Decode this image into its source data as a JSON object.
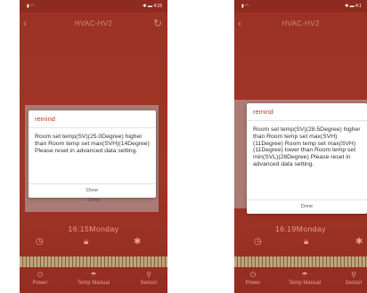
{
  "screen_left": {
    "status_left": "▮ ◠",
    "status_right": "✱ ▬ 4:15",
    "app_title": "HVAC-HV2",
    "dialog": {
      "title": "remind",
      "message": "Room set temp(SV)(25.0Degree) higher than Room temp set max(SVH)(14Degree) Please reset in advanced data setting.",
      "done_label": "Done"
    },
    "behind_done_label": "Done",
    "time_label": "16:15Monday",
    "bottom_buttons": [
      {
        "label": "Power",
        "icon": "power-icon"
      },
      {
        "label": "Temp Manual",
        "icon": "temp-manual-icon"
      },
      {
        "label": "Sensor",
        "icon": "sensor-icon"
      }
    ]
  },
  "screen_right": {
    "status_left": "▮ ◠",
    "status_right": "✱ ▬ 4:1",
    "app_title": "HVAC-HV2",
    "dialog": {
      "title": "remind",
      "message": "Room set temp(SV)(28.5Degree) higher than Room temp set max(SVH)(11Degree) Room temp set max(SVH) (11Degree) lower than Room temp set min(SVL)(28Degree) Please reset in advanced data setting.",
      "done_label": "Done"
    },
    "time_label": "16:19Monday",
    "bottom_buttons": [
      {
        "label": "Power",
        "icon": "power-icon"
      },
      {
        "label": "Temp Manual",
        "icon": "temp-manual-icon"
      },
      {
        "label": "Sensor",
        "icon": "sensor-icon"
      }
    ]
  },
  "colors": {
    "app_background": "#b83e2c",
    "dialog_title": "#c43a2c",
    "muted_icon": "#e8a090"
  }
}
